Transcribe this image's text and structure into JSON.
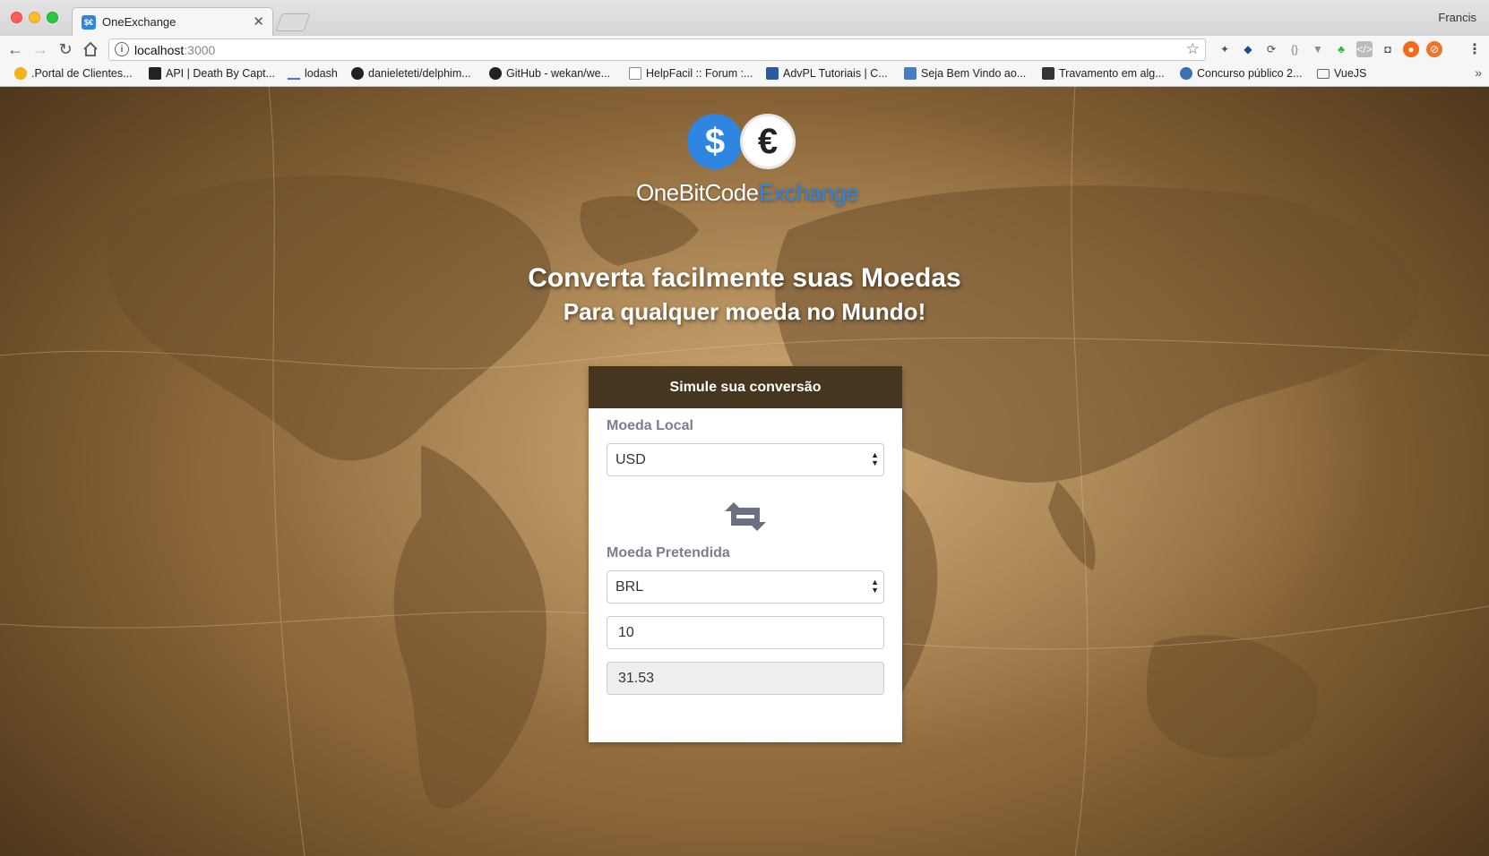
{
  "browser": {
    "tab_title": "OneExchange",
    "profile_name": "Francis",
    "url_host": "localhost",
    "url_port": ":3000",
    "bookmarks": [
      ".Portal de Clientes...",
      "API | Death By Capt...",
      "lodash",
      "danieleteti/delphim...",
      "GitHub - wekan/we...",
      "HelpFacil :: Forum :...",
      "AdvPL Tutoriais | C...",
      "Seja Bem Vindo ao...",
      "Travamento em alg...",
      "Concurso público 2...",
      "VueJS"
    ],
    "more_bookmarks": "»"
  },
  "page": {
    "brand_part1": "OneBitCode",
    "brand_part2": "Exchange",
    "brand_accent_color": "#2f86e0",
    "headline": "Converta facilmente suas Moedas",
    "subheadline": "Para qualquer moeda no Mundo!",
    "converter": {
      "header": "Simule sua conversão",
      "local_label": "Moeda Local",
      "local_value": "USD",
      "target_label": "Moeda Pretendida",
      "target_value": "BRL",
      "amount_value": "10",
      "result_value": "31.53"
    }
  }
}
